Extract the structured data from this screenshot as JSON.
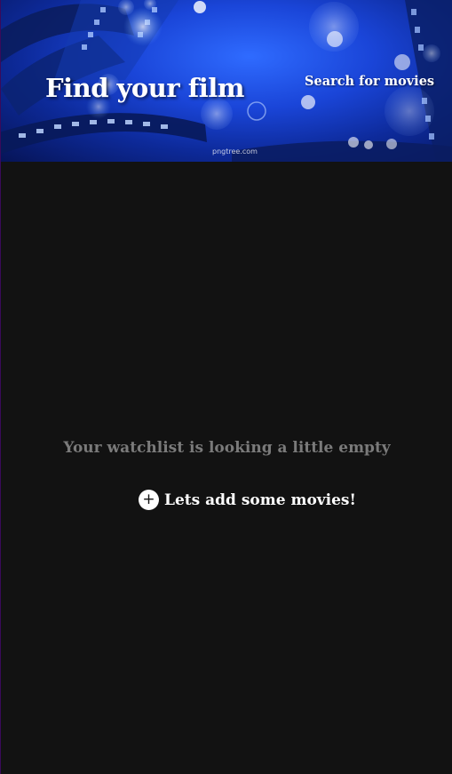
{
  "header": {
    "title": "Find your film",
    "search_link": "Search for movies",
    "watermark": "pngtree.com"
  },
  "main": {
    "empty_message": "Your watchlist is looking a little empty",
    "add_button": {
      "icon": "plus-icon",
      "label": "Lets add some movies!"
    }
  },
  "colors": {
    "background": "#121212",
    "empty_text": "#7a7a7a",
    "hero_blue": "#1a45d8"
  }
}
